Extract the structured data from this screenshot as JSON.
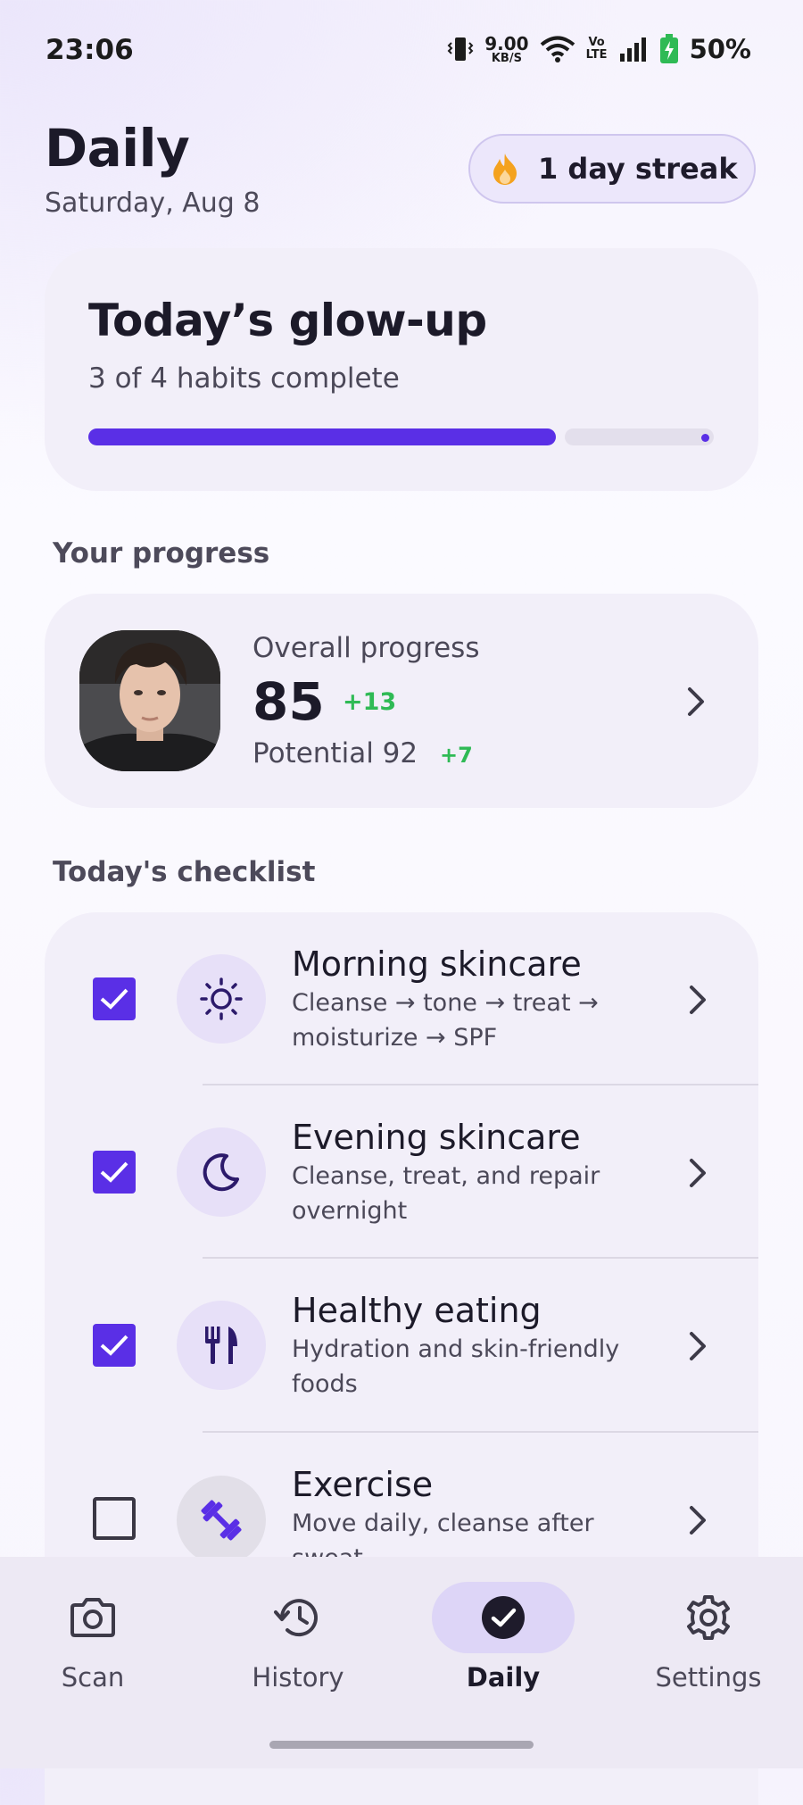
{
  "status_bar": {
    "time": "23:06",
    "net_speed": "9.00",
    "net_unit": "KB/S",
    "volte": "Vo LTE",
    "battery": "50%"
  },
  "header": {
    "title": "Daily",
    "date": "Saturday, Aug 8",
    "streak": "1 day streak"
  },
  "glowup": {
    "title": "Today’s glow-up",
    "subtitle": "3 of 4 habits complete",
    "progress": 0.75
  },
  "progress_section": {
    "label": "Your progress",
    "overall_label": "Overall progress",
    "overall_score": "85",
    "overall_delta": "+13",
    "potential_label": "Potential 92",
    "potential_delta": "+7"
  },
  "checklist": {
    "label": "Today's checklist",
    "items": [
      {
        "title": "Morning skincare",
        "desc": "Cleanse → tone → treat → moisturize → SPF",
        "checked": true,
        "icon": "sun-icon"
      },
      {
        "title": "Evening skincare",
        "desc": "Cleanse, treat, and repair overnight",
        "checked": true,
        "icon": "moon-icon"
      },
      {
        "title": "Healthy eating",
        "desc": "Hydration and skin-friendly foods",
        "checked": true,
        "icon": "fork-knife-icon"
      },
      {
        "title": "Exercise",
        "desc": "Move daily, cleanse after sweat",
        "checked": false,
        "icon": "dumbbell-icon"
      }
    ]
  },
  "nav": {
    "items": [
      {
        "label": "Scan",
        "icon": "camera-icon"
      },
      {
        "label": "History",
        "icon": "history-icon"
      },
      {
        "label": "Daily",
        "icon": "check-circle-icon",
        "active": true
      },
      {
        "label": "Settings",
        "icon": "gear-icon"
      }
    ]
  },
  "colors": {
    "accent": "#5a2fe6",
    "positive": "#2fba55",
    "streak_flame": "#f4a21f"
  }
}
